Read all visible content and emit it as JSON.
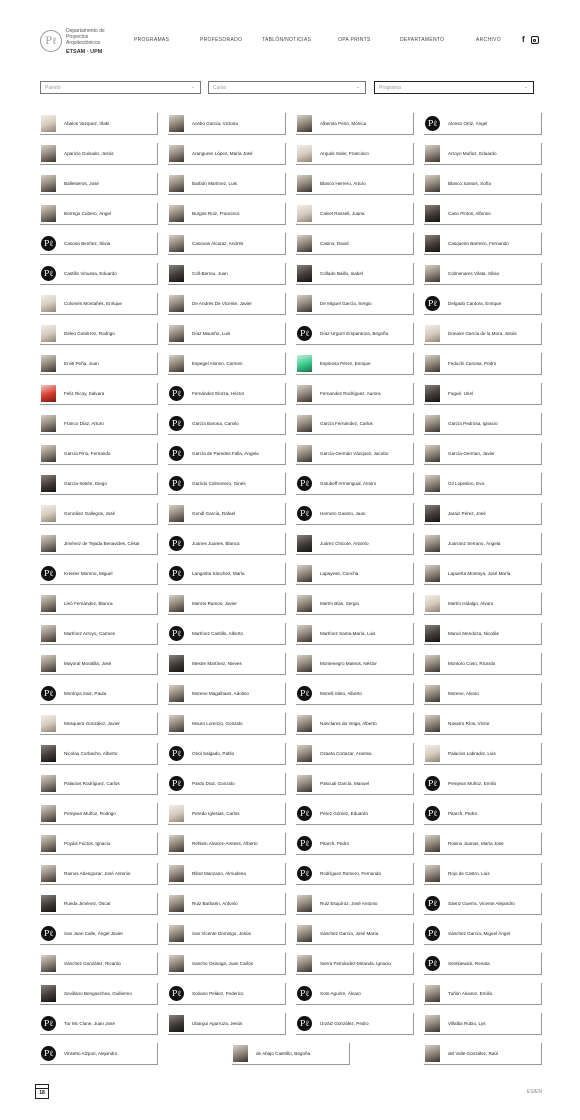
{
  "logo": {
    "lines": [
      "Departamento de",
      "Proyectos",
      "Arquitectónicos"
    ],
    "school": "ETSAM · UPM",
    "mark": "Pℓ"
  },
  "nav": {
    "items": [
      "PROGRAMAS",
      "PROFESORADO",
      "TABLÓN/NOTICIAS",
      "OPA PRINTS",
      "DEPARTAMENTO",
      "ARCHIVO"
    ]
  },
  "social": {
    "facebook": "f",
    "instagram_icon": "instagram-icon"
  },
  "filters": {
    "f1": "Puesto",
    "f2": "Curso",
    "f3": "Programa",
    "chevron": "⌄"
  },
  "people": [
    [
      "Abalos Vazquez, Iñaki",
      "Acebo García, Victoria",
      "Alberola Peiró, Mónica",
      "Alonso Ortiz, Ángel"
    ],
    [
      "Aparicio Guisado, Jesús",
      "Aranguren López, María José",
      "Arqués Soler, Francisco",
      "Arroyo Muñoz, Eduardo"
    ],
    [
      "Ballesteros, José",
      "Barbón Martínez, Luis",
      "Blanco Herrero, Arturo",
      "Blanco Santos, Sofía"
    ],
    [
      "Borrego Cubero, Ángel",
      "Burgos Ruiz, Francisco",
      "Calvet Rossell, Juana",
      "Cano Pintos, Alfonso"
    ],
    [
      "Canosa Benítez, Silvia",
      "Canovas Alcaraz, Andrés",
      "Casino, David",
      "Casqueiro Barreiro, Fernando"
    ],
    [
      "Castillo Vinuesa, Eduardo",
      "Coll-Barreu, Juan",
      "Collado Baillo, Isabel",
      "Colmenares Vilata, Silvia"
    ],
    [
      "Colomés Montañés, Enrique",
      "De Andrés De Vicente, Javier",
      "De Miguel García, Sergio",
      "Delgado Cantora, Enrique"
    ],
    [
      "Deleo Gutiérrez, Rodrigo",
      "Díaz Mauriño, Luis",
      "Díaz-Urgorri Emparanza, Begoña",
      "Donaire García de la Mora, Jesús"
    ],
    [
      "Erviti Peña, Juan",
      "Espegel Alonso, Carmen",
      "Espinosa Pérez, Enrique",
      "Feduchi Canosa, Pedro"
    ],
    [
      "Feliz Ricoy, Salvara",
      "Fernández Elorza, Héctor",
      "Fernandez Rodríguez, Aurora",
      "Foguè, Uriel"
    ],
    [
      "Franco Díaz, Arturo",
      "García Barona, Camilo",
      "García Fernández, Carlos",
      "García Pedrosa, Ignacio"
    ],
    [
      "García Pino, Fernando",
      "García de Paredes Falla, Ángela",
      "García-Germán Vázquez, Jacobo",
      "García-German, Javier"
    ],
    [
      "García-Setién, Diego",
      "Garrido Colmenero, Ginés",
      "Golubeff Armengual, Antoni",
      "Gil Lopesino, Eva"
    ],
    [
      "González Gallegos, José",
      "Gondl García, Rafael",
      "Hornero Gaomo, Juan",
      "Jaraiz Pérez, José"
    ],
    [
      "Jiménez de Tejada Benavides, César",
      "Juanes Juanes, Blanca",
      "Juárez Chicote, Antonio",
      "Juarranz Serrano, Ángela"
    ],
    [
      "Kreisler Moreno, Miguel",
      "Langarita Sánchez, María",
      "Lapayese, Concha",
      "Lapuerta Montoya, José María"
    ],
    [
      "Lleó Fernández, Blanca",
      "Maroto Ramos, Javier",
      "Martín Blas, Sergio",
      "Martín Hidalgo, Alvaro"
    ],
    [
      "Martínez Arroyo, Carmen",
      "Martínez Castillo, Alberto",
      "Martínez Santa-María, Luis",
      "Maruri Mendoza, Nicolás"
    ],
    [
      "Mayoral Moratilla, José",
      "Mestre Martínez, Nieves",
      "Montenegro Mateos, Néstor",
      "Montoro Coso, Ricardo"
    ],
    [
      "Montoya Saiz, Paula",
      "Moreno Magalhaes, Adolino",
      "Morelli Sileo, Alberto",
      "Moreno, Alvaro"
    ],
    [
      "Mosquera González, Javier",
      "Mouro Lorenzo, Gonzalo",
      "Nanclares da Veiga, Alberto",
      "Navarro Ríos, Víctor"
    ],
    [
      "Nicolau Corbacho, Alberto",
      "Oriol Salgado, Pablo",
      "Ozaeta Cortazar, Arantxa",
      "Palacios Labrador, Luis"
    ],
    [
      "Palacios Rodríguez, Carlos",
      "Pardo Díaz, Gonzalo",
      "Pascual García, Manuel",
      "Pemjean Muñoz, Emilio"
    ],
    [
      "Pemjean Muñoz, Rodrigo",
      "Peredo Iglesias, Carlos",
      "Pérez Gómez, Eduardo",
      "Pitarch, Pedro"
    ],
    [
      "Poyáis Fúctos, Ignacio",
      "Rehlein Alvarez-Amtess, Alberto",
      "Pitarch, Pedro",
      "Rosino Juanas, María Jose"
    ],
    [
      "Ramos Abengozar, José Antonio",
      "Ribot Manzano, Almudena",
      "Rodríguez Romero, Fernando",
      "Rojo de Castro, Luis"
    ],
    [
      "Rueda Jiménez, Óscar",
      "Ruiz Barbarin, Antonio",
      "Ruiz Esquíroz, José Antonio",
      "Sáenz Guerra, Vicente Alejandro"
    ],
    [
      "San Juan Calle, Ángel Javier",
      "San Vicente Domingo, Jesús",
      "Sánchez García, José María",
      "Sánchez García, Miguel Ángel"
    ],
    [
      "Sánchez González, Ricardo",
      "Sancho Osinaga, Juan Carlos",
      "Sierra Fernández-Miranda, Ignacio",
      "Sentkiewick, Renata"
    ],
    [
      "Sevillano Bengoechea, Guillermo",
      "Soriano Peláez, Federico",
      "Soto Aguirre, Álvaro",
      "Tuñón Alvarez, Emilio"
    ],
    [
      "Tur Mc Clune, Juan José",
      "Ubargui Agurruza, Jesús",
      "Urzáiz González, Pedro",
      "Villalba Rubio, Lys"
    ],
    [
      "Vinsetto Alzpuri, Alejandro",
      "de Abajo Castrillo, Begoña",
      "del Valle González, Raúl"
    ]
  ],
  "photo_types": [
    [
      "photo light",
      "photo",
      "photo",
      "pe"
    ],
    [
      "photo",
      "photo",
      "photo light",
      "photo"
    ],
    [
      "photo",
      "photo",
      "photo",
      "photo"
    ],
    [
      "photo",
      "photo",
      "photo light",
      "photo dark"
    ],
    [
      "pe",
      "photo",
      "photo",
      "photo dark"
    ],
    [
      "pe",
      "photo dark",
      "photo dark",
      "photo"
    ],
    [
      "photo light",
      "photo",
      "photo",
      "pe"
    ],
    [
      "photo light",
      "photo",
      "pe",
      "photo light"
    ],
    [
      "photo",
      "photo",
      "photo green",
      "photo"
    ],
    [
      "photo red",
      "pe",
      "photo",
      "photo dark"
    ],
    [
      "photo",
      "pe",
      "photo",
      "photo"
    ],
    [
      "photo",
      "pe",
      "photo",
      "photo"
    ],
    [
      "photo dark",
      "pe",
      "pe",
      "photo"
    ],
    [
      "photo light",
      "photo",
      "pe",
      "photo dark"
    ],
    [
      "photo",
      "pe",
      "photo dark",
      "photo"
    ],
    [
      "pe",
      "pe",
      "photo",
      "photo"
    ],
    [
      "photo",
      "photo",
      "photo",
      "photo light"
    ],
    [
      "photo",
      "pe",
      "photo",
      "photo dark"
    ],
    [
      "photo",
      "photo dark",
      "photo",
      "photo"
    ],
    [
      "pe",
      "photo",
      "pe",
      "photo"
    ],
    [
      "photo light",
      "photo",
      "photo",
      "photo"
    ],
    [
      "photo dark",
      "pe",
      "photo",
      "photo light"
    ],
    [
      "photo",
      "pe",
      "photo",
      "pe"
    ],
    [
      "photo",
      "photo light",
      "pe",
      "pe"
    ],
    [
      "photo",
      "photo",
      "pe",
      "photo"
    ],
    [
      "photo",
      "photo",
      "pe",
      "photo"
    ],
    [
      "photo dark",
      "photo",
      "photo",
      "pe"
    ],
    [
      "pe",
      "photo",
      "photo",
      "pe"
    ],
    [
      "photo",
      "photo",
      "photo",
      "pe"
    ],
    [
      "photo dark",
      "pe",
      "pe",
      "photo"
    ],
    [
      "pe",
      "photo dark",
      "pe",
      "photo"
    ],
    [
      "pe",
      "photo",
      "photo"
    ]
  ],
  "footer": {
    "page": "18",
    "lang": "ES/EN"
  }
}
